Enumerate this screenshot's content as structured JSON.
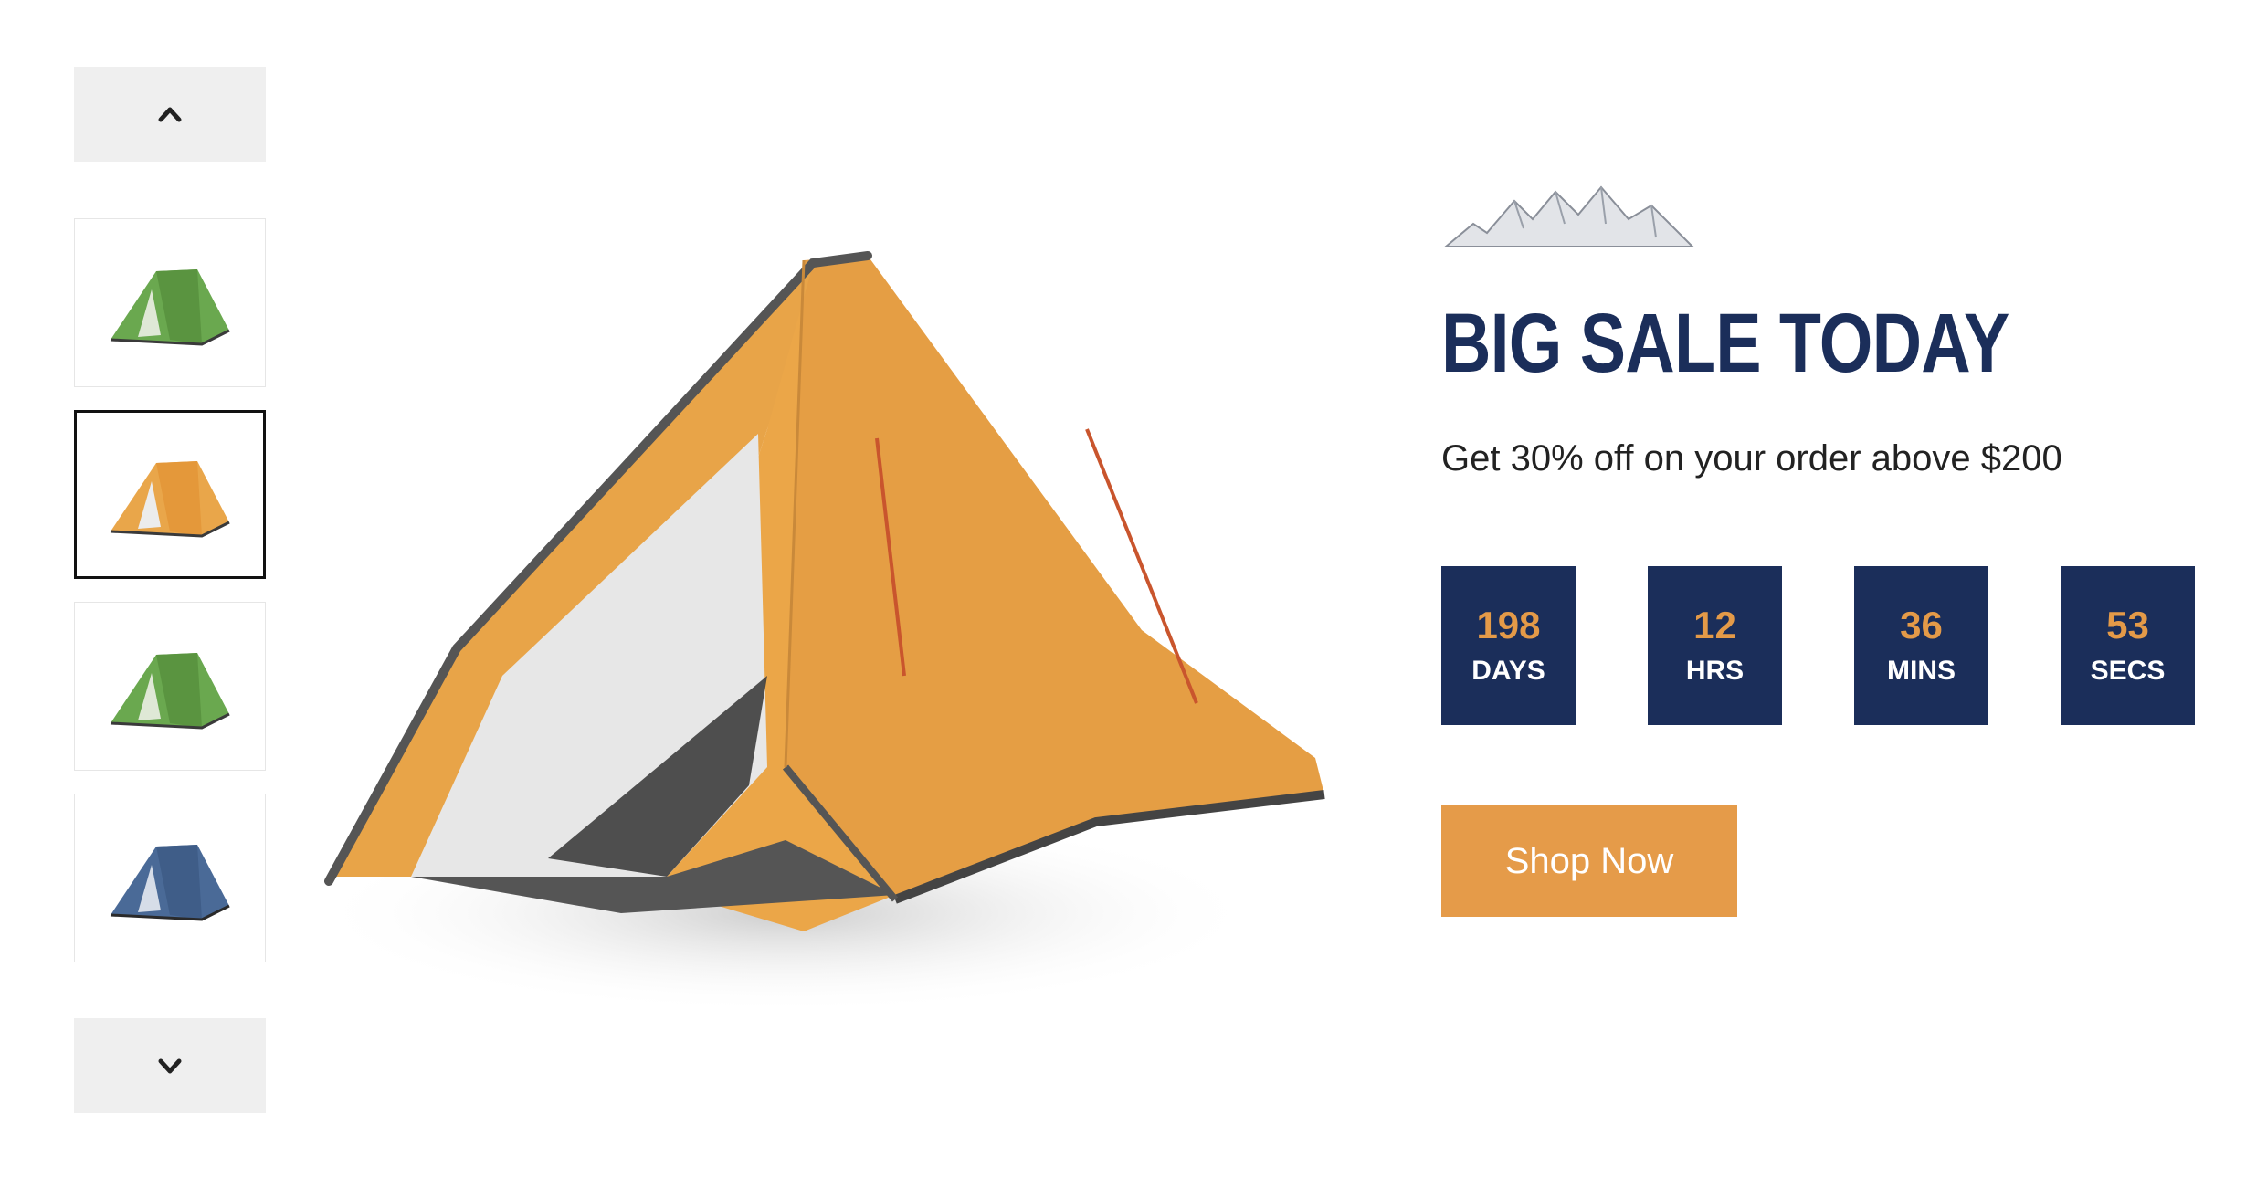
{
  "gallery": {
    "up_icon": "chevron-up-icon",
    "down_icon": "chevron-down-icon",
    "thumbnails": [
      {
        "color": "#6aa84f",
        "selected": false
      },
      {
        "color": "#e9a64a",
        "selected": true
      },
      {
        "color": "#6aa84f",
        "selected": false
      },
      {
        "color": "#4a6a97",
        "selected": false
      }
    ]
  },
  "promo": {
    "headline": "BIG SALE TODAY",
    "subtitle": "Get 30% off on your order above $200",
    "countdown": [
      {
        "value": "198",
        "label": "DAYS"
      },
      {
        "value": "12",
        "label": "HRS"
      },
      {
        "value": "36",
        "label": "MINS"
      },
      {
        "value": "53",
        "label": "SECS"
      }
    ],
    "cta_label": "Shop Now"
  },
  "colors": {
    "navy": "#1b2e5a",
    "accent_orange": "#e59b49",
    "countdown_value": "#e49a48"
  }
}
